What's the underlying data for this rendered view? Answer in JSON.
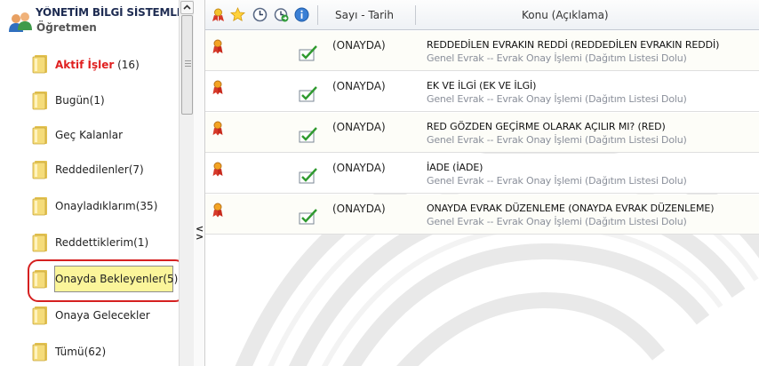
{
  "sidebar": {
    "title": "YÖNETİM BİLGİ SİSTEMLERİ",
    "subtitle": "Öğretmen",
    "folders": [
      {
        "label": "Aktif İşler",
        "count": " (16)"
      },
      {
        "label": "Bugün(1)"
      },
      {
        "label": "Geç Kalanlar"
      },
      {
        "label": "Reddedilenler(7)"
      },
      {
        "label": "Onayladıklarım(35)"
      },
      {
        "label": "Reddettiklerim(1)"
      },
      {
        "label": "Onayda Bekleyenler(5)"
      },
      {
        "label": "Onaya Gelecekler"
      },
      {
        "label": "Tümü(62)"
      }
    ],
    "selected_folder": "Onayda Bekleyenler(5)"
  },
  "table": {
    "columns": {
      "date": "Sayı - Tarih",
      "subject": "Konu (Açıklama)"
    },
    "header_icons": [
      "medal-icon",
      "star-icon",
      "clock-icon",
      "clock-arrow-icon",
      "info-icon"
    ],
    "rows": [
      {
        "status": "(ONAYDA)",
        "subject": "REDDEDİLEN EVRAKIN REDDİ    (REDDEDİLEN EVRAKIN REDDİ)",
        "detail": "Genel Evrak -- Evrak Onay İşlemi (Dağıtım Listesi Dolu)"
      },
      {
        "status": "(ONAYDA)",
        "subject": "EK VE İLGİ    (EK VE İLGİ)",
        "detail": "Genel Evrak -- Evrak Onay İşlemi (Dağıtım Listesi Dolu)"
      },
      {
        "status": "(ONAYDA)",
        "subject": "RED GÖZDEN GEÇİRME OLARAK AÇILIR MI?    (RED)",
        "detail": "Genel Evrak -- Evrak Onay İşlemi (Dağıtım Listesi Dolu)"
      },
      {
        "status": "(ONAYDA)",
        "subject": "İADE    (İADE)",
        "detail": "Genel Evrak -- Evrak Onay İşlemi (Dağıtım Listesi Dolu)"
      },
      {
        "status": "(ONAYDA)",
        "subject": "ONAYDA EVRAK DÜZENLEME    (ONAYDA EVRAK DÜZENLEME)",
        "detail": "Genel Evrak -- Evrak Onay İşlemi (Dağıtım Listesi Dolu)"
      }
    ]
  },
  "colors": {
    "active_folder": "#e02020",
    "selected_bg": "#fbf59a",
    "annotation_ring": "#d52020",
    "check_green": "#2f9a2f",
    "detail_text": "#8a8f9a"
  }
}
